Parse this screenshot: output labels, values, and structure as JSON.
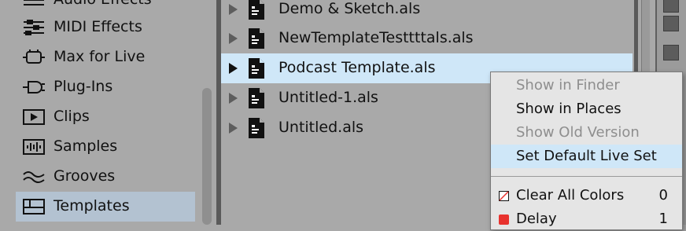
{
  "sidebar": {
    "items": [
      {
        "label": "Audio Effects",
        "icon": "audio-effects-icon"
      },
      {
        "label": "MIDI Effects",
        "icon": "midi-effects-icon"
      },
      {
        "label": "Max for Live",
        "icon": "max-for-live-icon"
      },
      {
        "label": "Plug-Ins",
        "icon": "plug-ins-icon"
      },
      {
        "label": "Clips",
        "icon": "clips-icon"
      },
      {
        "label": "Samples",
        "icon": "samples-icon"
      },
      {
        "label": "Grooves",
        "icon": "grooves-icon"
      },
      {
        "label": "Templates",
        "icon": "templates-icon",
        "selected": true
      }
    ]
  },
  "files": {
    "items": [
      {
        "name": "Demo & Sketch.als"
      },
      {
        "name": "NewTemplateTesttttals.als"
      },
      {
        "name": "Podcast Template.als",
        "selected": true
      },
      {
        "name": "Untitled-1.als"
      },
      {
        "name": "Untitled.als"
      }
    ]
  },
  "context_menu": {
    "items": [
      {
        "label": "Show in Finder",
        "enabled": false
      },
      {
        "label": "Show in Places",
        "enabled": true
      },
      {
        "label": "Show Old Version",
        "enabled": false
      },
      {
        "label": "Set Default Live Set",
        "enabled": true,
        "highlighted": true
      }
    ],
    "color_items": [
      {
        "label": "Clear All Colors",
        "shortcut": "0",
        "swatch": "clear"
      },
      {
        "label": "Delay",
        "shortcut": "1",
        "swatch": "#e8322e"
      }
    ]
  },
  "colors": {
    "selected_row": "#cfe7f8",
    "sidebar_selected": "#b3c2d1",
    "delay_swatch": "#e8322e"
  }
}
